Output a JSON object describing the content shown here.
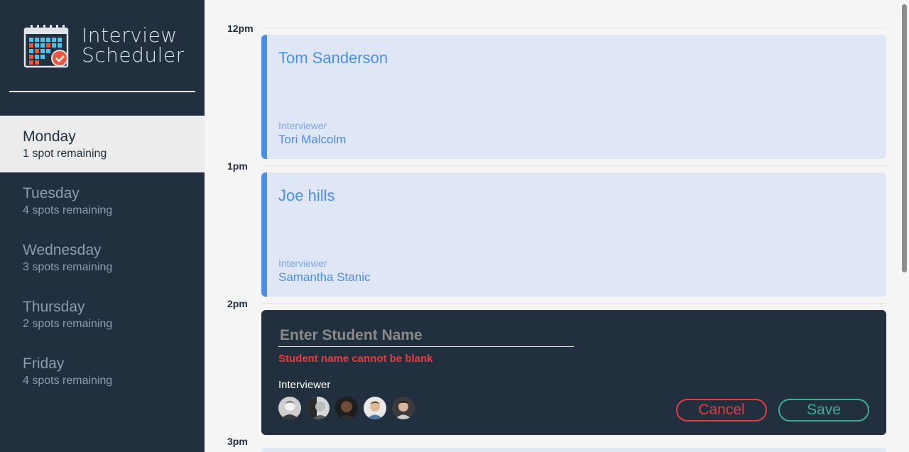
{
  "brand": {
    "title_line1": "Interview",
    "title_line2": "Scheduler"
  },
  "days": [
    {
      "name": "Monday",
      "spots": "1 spot remaining",
      "selected": true
    },
    {
      "name": "Tuesday",
      "spots": "4 spots remaining",
      "selected": false
    },
    {
      "name": "Wednesday",
      "spots": "3 spots remaining",
      "selected": false
    },
    {
      "name": "Thursday",
      "spots": "2 spots remaining",
      "selected": false
    },
    {
      "name": "Friday",
      "spots": "4 spots remaining",
      "selected": false
    }
  ],
  "times": [
    "12pm",
    "1pm",
    "2pm",
    "3pm"
  ],
  "appointments": [
    {
      "student": "Tom Sanderson",
      "interviewer_label": "Interviewer",
      "interviewer": "Tori Malcolm"
    },
    {
      "student": "Joe hills",
      "interviewer_label": "Interviewer",
      "interviewer": "Samantha Stanic"
    }
  ],
  "form": {
    "placeholder": "Enter Student Name",
    "value": "",
    "error": "Student name cannot be blank",
    "interviewer_label": "Interviewer",
    "cancel_label": "Cancel",
    "save_label": "Save"
  },
  "colors": {
    "sidebar": "#222f3e",
    "accent_blue": "#4a8ee8",
    "card_bg": "#dfe6f6",
    "danger": "#e53d3d",
    "success": "#3fae8c"
  }
}
